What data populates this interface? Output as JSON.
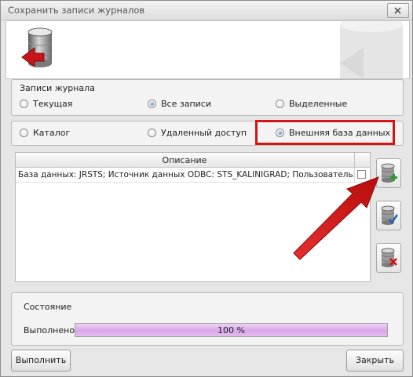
{
  "window": {
    "title": "Сохранить записи журналов"
  },
  "journal_group": {
    "label": "Записи журнала",
    "options": [
      {
        "label": "Текущая",
        "checked": false
      },
      {
        "label": "Все записи",
        "checked": true
      },
      {
        "label": "Выделенные",
        "checked": false
      }
    ]
  },
  "destination_group": {
    "options": [
      {
        "label": "Каталог",
        "checked": false
      },
      {
        "label": "Удаленный доступ",
        "checked": false
      },
      {
        "label": "Внешняя база данных",
        "checked": true
      }
    ]
  },
  "table": {
    "columns": [
      "Описание",
      ""
    ],
    "rows": [
      {
        "description": "База данных: JRSTS; Источник данных ODBC: STS_KALINIGRAD; Пользователь:",
        "checked": false
      }
    ]
  },
  "side_buttons": [
    {
      "icon": "database-add-icon"
    },
    {
      "icon": "database-edit-icon"
    },
    {
      "icon": "database-delete-icon"
    }
  ],
  "status": {
    "label": "Состояние",
    "progress_label": "Выполнено",
    "progress_text": "100 %",
    "progress_fraction": 1.0
  },
  "buttons": {
    "run_label": "Выполнить",
    "close_label": "Закрыть"
  },
  "colors": {
    "highlight": "#d41414",
    "arrow": "#d41414",
    "progress": "#d7a6e9"
  }
}
